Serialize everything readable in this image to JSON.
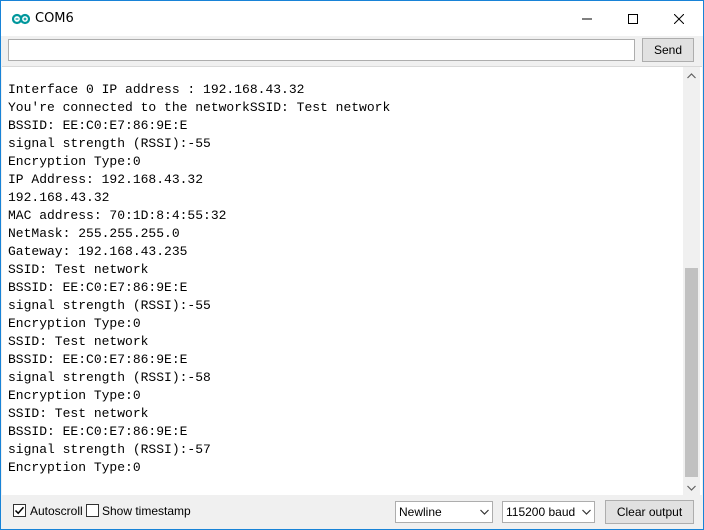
{
  "window": {
    "title": "COM6",
    "accent_color": "#1883d7",
    "icon": "arduino-infinity-icon"
  },
  "controls": {
    "minimize_icon": "minimize-icon",
    "maximize_icon": "maximize-icon",
    "close_icon": "close-icon"
  },
  "toolbar": {
    "input_value": "",
    "send_label": "Send"
  },
  "console": {
    "lines": [
      "Interface 0 IP address : 192.168.43.32",
      "You're connected to the networkSSID: Test network",
      "BSSID: EE:C0:E7:86:9E:E",
      "signal strength (RSSI):-55",
      "Encryption Type:0",
      "IP Address: 192.168.43.32",
      "192.168.43.32",
      "MAC address: 70:1D:8:4:55:32",
      "NetMask: 255.255.255.0",
      "Gateway: 192.168.43.235",
      "SSID: Test network",
      "BSSID: EE:C0:E7:86:9E:E",
      "signal strength (RSSI):-55",
      "Encryption Type:0",
      "SSID: Test network",
      "BSSID: EE:C0:E7:86:9E:E",
      "signal strength (RSSI):-58",
      "Encryption Type:0",
      "SSID: Test network",
      "BSSID: EE:C0:E7:86:9E:E",
      "signal strength (RSSI):-57",
      "Encryption Type:0"
    ]
  },
  "statusbar": {
    "autoscroll_label": "Autoscroll",
    "autoscroll_checked": true,
    "timestamp_label": "Show timestamp",
    "timestamp_checked": false,
    "line_ending": "Newline",
    "baud_rate": "115200 baud",
    "clear_label": "Clear output"
  }
}
